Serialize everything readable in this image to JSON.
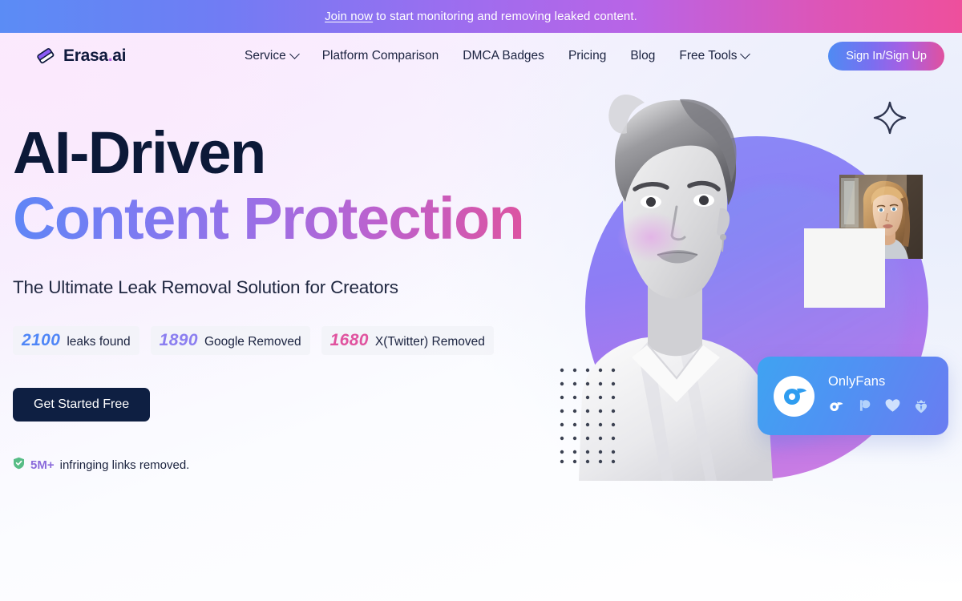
{
  "banner": {
    "link_label": "Join now",
    "text": "to start monitoring and removing leaked content."
  },
  "nav": {
    "logo": {
      "icon": "eraser-icon",
      "name": "Erasa",
      "dot": ".",
      "suffix": "ai"
    },
    "links": [
      {
        "label": "Service",
        "has_chevron": true
      },
      {
        "label": "Platform Comparison",
        "has_chevron": false
      },
      {
        "label": "DMCA Badges",
        "has_chevron": false
      },
      {
        "label": "Pricing",
        "has_chevron": false
      },
      {
        "label": "Blog",
        "has_chevron": false
      },
      {
        "label": "Free Tools",
        "has_chevron": true
      }
    ],
    "signin_label": "Sign In/Sign Up"
  },
  "hero": {
    "headline_line1": "AI-Driven",
    "headline_line2": "Content Protection",
    "subtitle": "The Ultimate Leak Removal Solution for Creators",
    "stats": [
      {
        "value": "2100",
        "label": "leaks found",
        "color": "#4f86f7"
      },
      {
        "value": "1890",
        "label": "Google Removed",
        "color": "#8b7ef0"
      },
      {
        "value": "1680",
        "label": "X(Twitter) Removed",
        "color": "#e0539f"
      }
    ],
    "cta_label": "Get Started Free",
    "trust": {
      "icon": "shield-check-icon",
      "count": "5M+",
      "text": "infringing links removed."
    }
  },
  "visual": {
    "sparkle_icon": "sparkle-star-icon",
    "portrait_alt": "creator-portrait",
    "thumbnail_alt": "creator-thumbnail",
    "platform_card": {
      "logo_icon": "onlyfans-icon",
      "title": "OnlyFans",
      "icons": [
        "onlyfans-icon",
        "patreon-icon",
        "heart-icon",
        "fansly-crown-icon"
      ]
    }
  },
  "colors": {
    "brand_blue": "#4f8bf3",
    "brand_purple": "#9a6fe6",
    "brand_pink": "#e0529c",
    "navy": "#0e1f42",
    "green": "#4caf7d"
  }
}
